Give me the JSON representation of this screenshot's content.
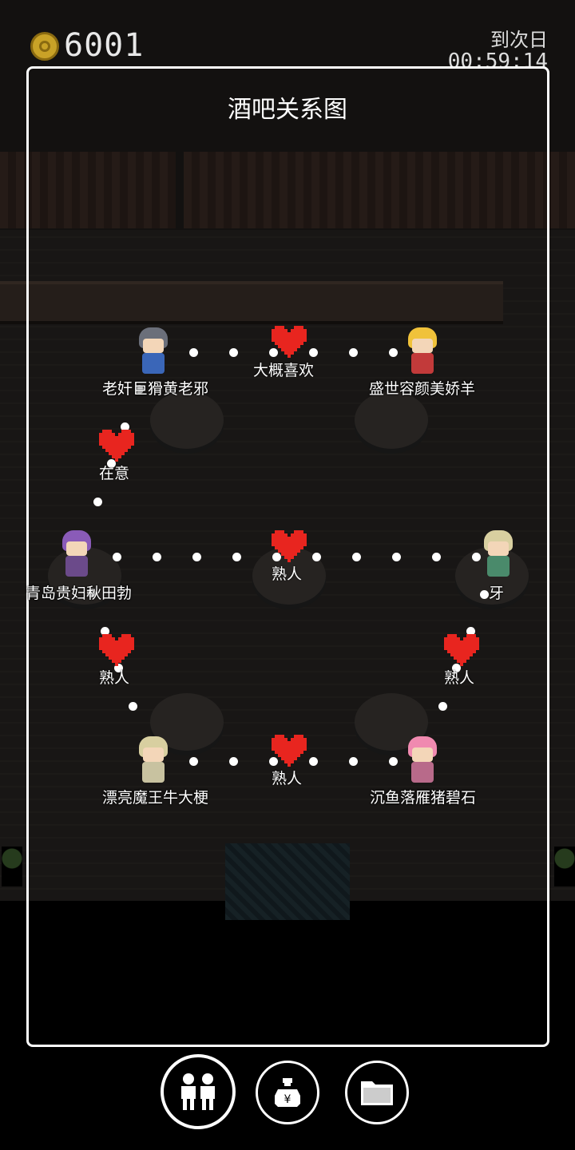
{
  "hud": {
    "money": "6001",
    "next_day_label": "到次日",
    "timer": "00:59:14"
  },
  "panel": {
    "title": "酒吧关系图"
  },
  "characters": [
    {
      "name": "老奸巨猾黄老邪",
      "hair": "#6b6f7a",
      "body": "#3a66b8"
    },
    {
      "name": "盛世容颜美娇羊",
      "hair": "#f0c23a",
      "body": "#c23a3a"
    },
    {
      "name": "青岛贵妇秋田勃",
      "hair": "#8a5bb8",
      "body": "#6b4a8a"
    },
    {
      "name": "牙",
      "hair": "#d8cfa0",
      "body": "#4a8a6b"
    },
    {
      "name": "漂亮魔王牛大梗",
      "hair": "#d8cfa0",
      "body": "#c8c2a0"
    },
    {
      "name": "沉鱼落雁猪碧石",
      "hair": "#f08ab0",
      "body": "#b86a8a"
    }
  ],
  "relations": [
    {
      "label": "大概喜欢"
    },
    {
      "label": "在意"
    },
    {
      "label": "熟人"
    },
    {
      "label": "熟人"
    },
    {
      "label": "熟人"
    },
    {
      "label": "熟人"
    }
  ],
  "colors": {
    "heart": "#e8251f",
    "line_dot": "#ffffff",
    "coin": "#c9a227"
  },
  "toolbar": [
    {
      "icon": "people-icon"
    },
    {
      "icon": "money-bag-icon"
    },
    {
      "icon": "folder-icon"
    }
  ]
}
